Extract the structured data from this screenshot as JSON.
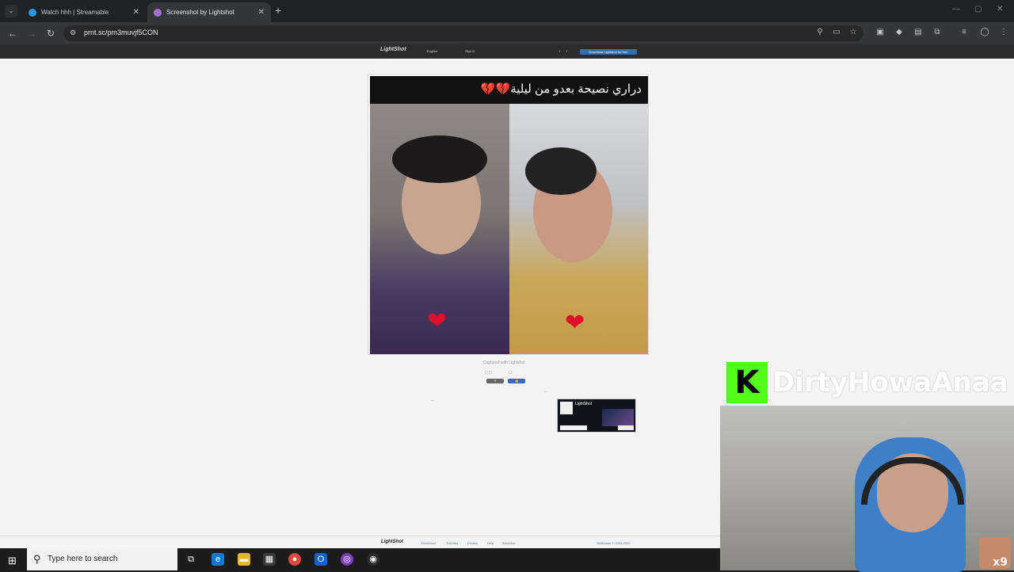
{
  "browser": {
    "tabs": [
      {
        "title": "Watch hhh | Streamable",
        "active": false
      },
      {
        "title": "Screenshot by Lightshot",
        "active": true
      }
    ],
    "url": "prnt.sc/pm3muvjf5CON"
  },
  "lightshot": {
    "logo": "LightShot",
    "nav": {
      "lang": "English",
      "signin": "Sign in",
      "download": "Download Lightshot for free"
    },
    "caption_text": "دراري نصيحة بعدو من ليلية💔💔",
    "captured": "Captured with Lightshot",
    "footer": {
      "links": [
        "Download",
        "Tutorials",
        "Privacy",
        "Help",
        "Advertise"
      ],
      "copyright": "Skillbrains © 2009-2022"
    }
  },
  "overlay": {
    "streamer_name": "DirtyHowaAnaa",
    "badge_text": "x9"
  },
  "taskbar": {
    "search_placeholder": "Type here to search"
  }
}
